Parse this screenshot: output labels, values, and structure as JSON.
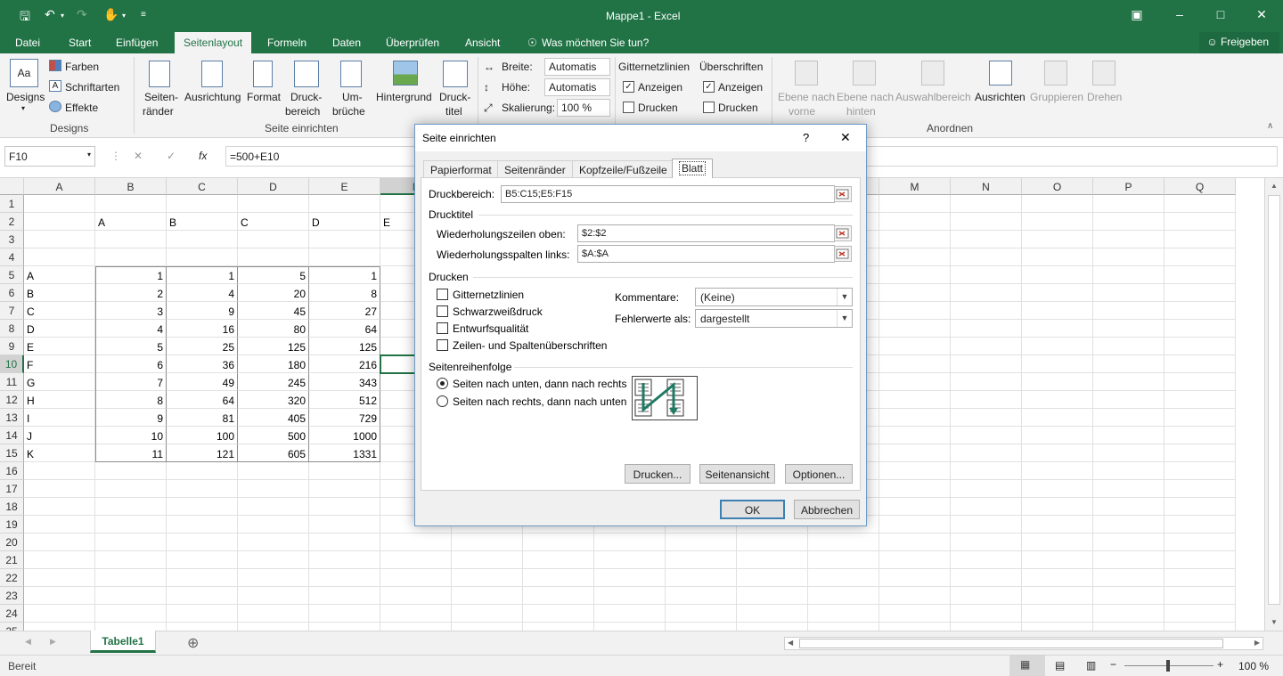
{
  "window": {
    "title": "Mappe1 - Excel"
  },
  "colors": {
    "accent": "#217346",
    "dialog_border": "#6d99c6"
  },
  "ribbon_tabs": [
    "Datei",
    "Start",
    "Einfügen",
    "Seitenlayout",
    "Formeln",
    "Daten",
    "Überprüfen",
    "Ansicht"
  ],
  "ribbon_active": "Seitenlayout",
  "tellme": "Was möchten Sie tun?",
  "share": "Freigeben",
  "ribbon": {
    "designs": {
      "designs": "Designs",
      "farben": "Farben",
      "schriftarten": "Schriftarten",
      "effekte": "Effekte",
      "group": "Designs"
    },
    "page_setup": {
      "seitenraender_1": "Seiten-",
      "seitenraender_2": "ränder",
      "ausrichtung": "Ausrichtung",
      "format": "Format",
      "druckbereich_1": "Druck-",
      "druckbereich_2": "bereich",
      "umbrueche_1": "Um-",
      "umbrueche_2": "brüche",
      "hintergrund": "Hintergrund",
      "drucktitel_1": "Druck-",
      "drucktitel_2": "titel",
      "group": "Seite einrichten"
    },
    "scale": {
      "breite": "Breite:",
      "breite_val": "Automatis",
      "hoehe": "Höhe:",
      "hoehe_val": "Automatis",
      "skalierung": "Skalierung:",
      "skalierung_val": "100 %"
    },
    "sheet_opts": {
      "gitter": "Gitternetzlinien",
      "gitter_anz": "Anzeigen",
      "gitter_dr": "Drucken",
      "ueber": "Überschriften",
      "ueber_anz": "Anzeigen",
      "ueber_dr": "Drucken"
    },
    "arrange": {
      "vor_1": "Ebene nach",
      "vor_2": "vorne",
      "hin_1": "Ebene nach",
      "hin_2": "hinten",
      "auswahl": "Auswahlbereich",
      "ausrichten": "Ausrichten",
      "gruppieren": "Gruppieren",
      "drehen": "Drehen",
      "group": "Anordnen"
    }
  },
  "formula": {
    "namebox": "F10",
    "fx": "fx",
    "value": "=500+E10"
  },
  "columns": [
    "A",
    "B",
    "C",
    "D",
    "E",
    "F",
    "G",
    "H",
    "I",
    "J",
    "K",
    "L",
    "M",
    "N",
    "O",
    "P",
    "Q"
  ],
  "rows": [
    "1",
    "2",
    "3",
    "4",
    "5",
    "6",
    "7",
    "8",
    "9",
    "10",
    "11",
    "12",
    "13",
    "14",
    "15",
    "16",
    "17",
    "18",
    "19",
    "20",
    "21",
    "22",
    "23",
    "24",
    "25"
  ],
  "cells": {
    "header_row": [
      "A",
      "B",
      "C",
      "D",
      "E"
    ],
    "labels": [
      "A",
      "B",
      "C",
      "D",
      "E",
      "F",
      "G",
      "H",
      "I",
      "J",
      "K"
    ],
    "colB": [
      "1",
      "2",
      "3",
      "4",
      "5",
      "6",
      "7",
      "8",
      "9",
      "10",
      "11"
    ],
    "colC": [
      "1",
      "4",
      "9",
      "16",
      "25",
      "36",
      "49",
      "64",
      "81",
      "100",
      "121"
    ],
    "colD": [
      "5",
      "20",
      "45",
      "80",
      "125",
      "180",
      "245",
      "320",
      "405",
      "500",
      "605"
    ],
    "colE": [
      "1",
      "8",
      "27",
      "64",
      "125",
      "216",
      "343",
      "512",
      "729",
      "1000",
      "1331"
    ]
  },
  "sheet": {
    "tab": "Tabelle1"
  },
  "status": {
    "ready": "Bereit",
    "zoom": "100 %"
  },
  "dialog": {
    "title": "Seite einrichten",
    "help": "?",
    "tabs": [
      "Papierformat",
      "Seitenränder",
      "Kopfzeile/Fußzeile",
      "Blatt"
    ],
    "active_tab": "Blatt",
    "druckbereich_label": "Druckbereich:",
    "druckbereich_val": "B5:C15;E5:F15",
    "drucktitel": "Drucktitel",
    "wdh_zeilen_label": "Wiederholungszeilen oben:",
    "wdh_zeilen_val": "$2:$2",
    "wdh_spalten_label": "Wiederholungsspalten links:",
    "wdh_spalten_val": "$A:$A",
    "drucken_section": "Drucken",
    "opt_gitter": "Gitternetzlinien",
    "opt_sw": "Schwarzweißdruck",
    "opt_entwurf": "Entwurfsqualität",
    "opt_zeilen": "Zeilen- und Spaltenüberschriften",
    "kommentare_label": "Kommentare:",
    "kommentare_val": "(Keine)",
    "fehler_label": "Fehlerwerte als:",
    "fehler_val": "dargestellt",
    "reihenfolge": "Seitenreihenfolge",
    "radio_1": "Seiten nach unten, dann nach rechts",
    "radio_2": "Seiten nach rechts, dann nach unten",
    "btn_drucken": "Drucken...",
    "btn_ansicht": "Seitenansicht",
    "btn_optionen": "Optionen...",
    "btn_ok": "OK",
    "btn_abbrechen": "Abbrechen"
  }
}
